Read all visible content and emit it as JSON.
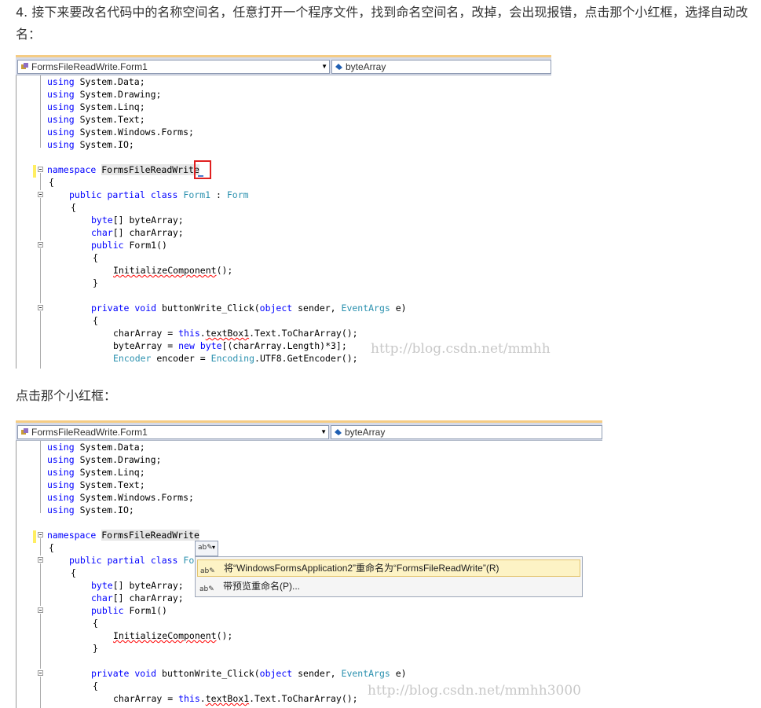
{
  "step_text": "4. 接下来要改名代码中的名称空间名，任意打开一个程序文件，找到命名空间名，改掉，会出现报错，点击那个小红框，选择自动改名：",
  "caption": "点击那个小红框：",
  "watermark": "http://blog.csdn.net/mmhh3000",
  "nav": {
    "class_combo": "FormsFileReadWrite.Form1",
    "member_combo": "byteArray"
  },
  "code": {
    "using_keyword": "using",
    "usings": [
      "System.Data;",
      "System.Drawing;",
      "System.Linq;",
      "System.Text;",
      "System.Windows.Forms;",
      "System.IO;"
    ],
    "namespace_keyword": "namespace",
    "namespace_name": "FormsFileReadWrite",
    "open_brace": "{",
    "close_brace": "}",
    "class_modifiers": "public partial class",
    "class_name": "Form1",
    "class_colon": ":",
    "class_base": "Form",
    "byte_type": "byte",
    "byte_decl": "[] byteArray;",
    "char_type": "char",
    "char_decl": "[] charArray;",
    "ctor_public": "public",
    "ctor_name": "Form1()",
    "init_call": "InitializeComponent",
    "init_tail": "();",
    "method_modifiers": "private void",
    "method_name": "buttonWrite_Click(",
    "object_kw": "object",
    "sender": " sender, ",
    "eventargs": "EventArgs",
    "e_param": " e)",
    "stmt1_a": "charArray = ",
    "this_kw": "this",
    "stmt1_dot": ".",
    "textbox": "textBox1",
    "stmt1_b": ".Text.ToCharArray();",
    "stmt2_a": "byteArray = ",
    "new_kw": "new",
    "stmt2_b": "[(charArray.Length)*3];",
    "encoder_type": "Encoder",
    "encoder_var": " encoder = ",
    "encoding_type": "Encoding",
    "encoder_tail": ".UTF8.GetEncoder();"
  },
  "smart_tag": {
    "ab_icon": "ab✎",
    "dropdown_arrow": "▾",
    "items": [
      "将“WindowsFormsApplication2”重命名为“FormsFileReadWrite”(R)",
      "带预览重命名(P)..."
    ]
  },
  "colors": {
    "keyword": "#0000ff",
    "type": "#2b91af",
    "red_box": "#e02020"
  }
}
